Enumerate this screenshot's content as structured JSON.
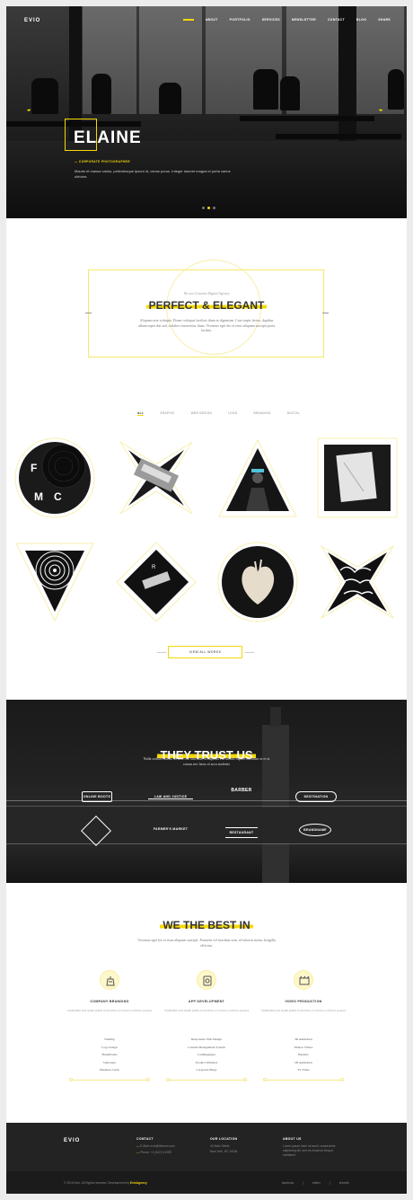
{
  "brand": "EVIO",
  "nav": [
    "ABOUT",
    "PORTFOLIO",
    "SERVICES",
    "NEWSLETTER",
    "CONTACT",
    "BLOG",
    "SHARE"
  ],
  "hero": {
    "title": "ELAINE",
    "subtitle": "CORPORATE PHOTOGRAPHER",
    "text": "Mauris et massa varius, pellentesque ipsum id, varius purus. Integer laoreet magna id porta varius ultricies"
  },
  "about": {
    "tagline": "We are Creative Digital Agency",
    "title": "PERFECT & ELEGANT",
    "text": "Aliquam erat volutpat. Donec volutpat facilisis diam at dignissim. Cras turpis lectus, dapibus ullamcorper dui sed, sodales consectetur diam. Vivamus eget leo et risus aliquam suscipit porta lacinia."
  },
  "portfolio": {
    "filters": [
      "ALL",
      "GRAPHIC",
      "WEB DESIGN",
      "LOGO",
      "BRANDING",
      "DIGITAL"
    ],
    "view_all": "VIEW ALL WORKS"
  },
  "trust": {
    "title": "THEY TRUST US",
    "text": "Nulla sodales massa sit amet mi faucibus, id dapibus elit iaculis Sapien tincidunt at et ut cursus nec lacus et arcu molestie",
    "clients": [
      "ONLINE BOOTS",
      "LAW AND JUSTICE",
      "BARBER",
      "DESTINATION",
      "FARMER'S MARKET",
      "RESTAURANT",
      "BRANDNAME"
    ]
  },
  "services": {
    "title": "WE THE BEST IN",
    "text": "Vivamus eget leo et risus aliquam suscipit. Praesent vel faucibus sem, id lobortis metus fringilla efficitur.",
    "items": [
      {
        "title": "COMPANY BRANDING",
        "desc": "Vestibulum ante ipsum primis in faucibus orci luctus et ultrices posuere",
        "list": [
          "Naming",
          "Logo design",
          "Brandbooks",
          "Stationery",
          "Business Cards"
        ]
      },
      {
        "title": "APP DEVELOPMENT",
        "desc": "Vestibulum ante ipsum primis in faucibus orci luctus et ultrices posuere",
        "list": [
          "Responsive Web Design",
          "Content Management System",
          "Landingpages",
          "Product Websites",
          "Corporate Blogs"
        ]
      },
      {
        "title": "VIDEO PRODUCTION",
        "desc": "Vestibulum ante ipsum primis in faucibus orci luctus et ultrices posuere",
        "list": [
          "3D Animation",
          "Motion Videos",
          "Banners",
          "2D Animation",
          "TV Video"
        ]
      }
    ]
  },
  "footer": {
    "brand": "EVIO",
    "contact_title": "CONTACT",
    "email_label": "E-Mail:",
    "email": "evio@themes.com",
    "phone_label": "Phone:",
    "phone": "+1 (347) 5 6789",
    "location_title": "OUR LOCATION",
    "address1": "40 Main Street",
    "address2": "New York, NY 10154",
    "about_title": "ABOUT US",
    "about_text": "Lorem ipsum dolor sit amet, consectetur adipiscing elit, sed do eiusmod tempor incididunt",
    "copyright": "© 2016 Evio. All Rights reserved. Development by",
    "credit": "EvioAgency",
    "social": [
      "facebook",
      "twitter",
      "linkedin"
    ]
  },
  "colors": {
    "accent": "#f5d90a",
    "dark": "#1b1b1b"
  }
}
